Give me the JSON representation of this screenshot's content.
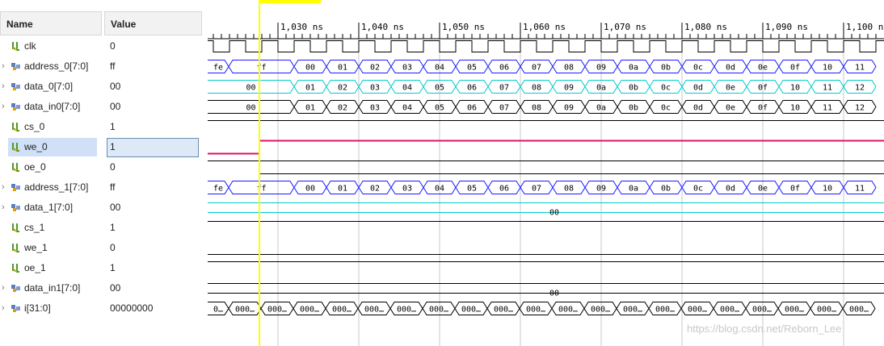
{
  "columns": {
    "name": "Name",
    "value": "Value"
  },
  "signals": [
    {
      "name": "clk",
      "value": "0",
      "type": "bit",
      "expandable": false,
      "selected": false
    },
    {
      "name": "address_0[7:0]",
      "value": "ff",
      "type": "bus",
      "expandable": true,
      "selected": false
    },
    {
      "name": "data_0[7:0]",
      "value": "00",
      "type": "bus",
      "expandable": true,
      "selected": false
    },
    {
      "name": "data_in0[7:0]",
      "value": "00",
      "type": "bus",
      "expandable": true,
      "selected": false
    },
    {
      "name": "cs_0",
      "value": "1",
      "type": "bit",
      "expandable": false,
      "selected": false
    },
    {
      "name": "we_0",
      "value": "1",
      "type": "bit",
      "expandable": false,
      "selected": true
    },
    {
      "name": "oe_0",
      "value": "0",
      "type": "bit",
      "expandable": false,
      "selected": false
    },
    {
      "name": "address_1[7:0]",
      "value": "ff",
      "type": "bus",
      "expandable": true,
      "selected": false
    },
    {
      "name": "data_1[7:0]",
      "value": "00",
      "type": "bus",
      "expandable": true,
      "selected": false
    },
    {
      "name": "cs_1",
      "value": "1",
      "type": "bit",
      "expandable": false,
      "selected": false
    },
    {
      "name": "we_1",
      "value": "0",
      "type": "bit",
      "expandable": false,
      "selected": false
    },
    {
      "name": "oe_1",
      "value": "1",
      "type": "bit",
      "expandable": false,
      "selected": false
    },
    {
      "name": "data_in1[7:0]",
      "value": "00",
      "type": "bus",
      "expandable": true,
      "selected": false
    },
    {
      "name": "i[31:0]",
      "value": "00000000",
      "type": "bus",
      "expandable": true,
      "selected": false
    }
  ],
  "timeline": {
    "unit": "ns",
    "labels": [
      "1,030 ns",
      "1,040 ns",
      "1,050 ns",
      "1,060 ns",
      "1,070 ns",
      "1,080 ns",
      "1,090 ns",
      "1,100 ns"
    ]
  },
  "waves": {
    "address_0": {
      "first": "fe",
      "second": "ff",
      "values": [
        "00",
        "01",
        "02",
        "03",
        "04",
        "05",
        "06",
        "07",
        "08",
        "09",
        "0a",
        "0b",
        "0c",
        "0d",
        "0e",
        "0f",
        "10",
        "11"
      ]
    },
    "data_0": {
      "first": "00",
      "values": [
        "01",
        "02",
        "03",
        "04",
        "05",
        "06",
        "07",
        "08",
        "09",
        "0a",
        "0b",
        "0c",
        "0d",
        "0e",
        "0f",
        "10",
        "11",
        "12"
      ]
    },
    "data_in0": {
      "first": "00",
      "values": [
        "01",
        "02",
        "03",
        "04",
        "05",
        "06",
        "07",
        "08",
        "09",
        "0a",
        "0b",
        "0c",
        "0d",
        "0e",
        "0f",
        "10",
        "11",
        "12"
      ]
    },
    "address_1": {
      "first": "fe",
      "second": "ff",
      "values": [
        "00",
        "01",
        "02",
        "03",
        "04",
        "05",
        "06",
        "07",
        "08",
        "09",
        "0a",
        "0b",
        "0c",
        "0d",
        "0e",
        "0f",
        "10",
        "11"
      ]
    },
    "data_1": {
      "value": "00"
    },
    "data_in1": {
      "value": "00"
    },
    "i": {
      "first": "0…",
      "values": [
        "000…",
        "000…",
        "000…",
        "000…",
        "000…",
        "000…",
        "000…",
        "000…",
        "000…",
        "000…",
        "000…",
        "000…",
        "000…",
        "000…",
        "000…",
        "000…",
        "000…",
        "000…",
        "000…",
        "000…"
      ]
    }
  },
  "colors": {
    "cursor": "#ffff00",
    "bus_x": "#1a1aff",
    "data_cyan": "#00cccc",
    "we_pink": "#e0106a",
    "grid": "#c8c8c8"
  },
  "watermark": "https://blog.csdn.net/Reborn_Lee"
}
